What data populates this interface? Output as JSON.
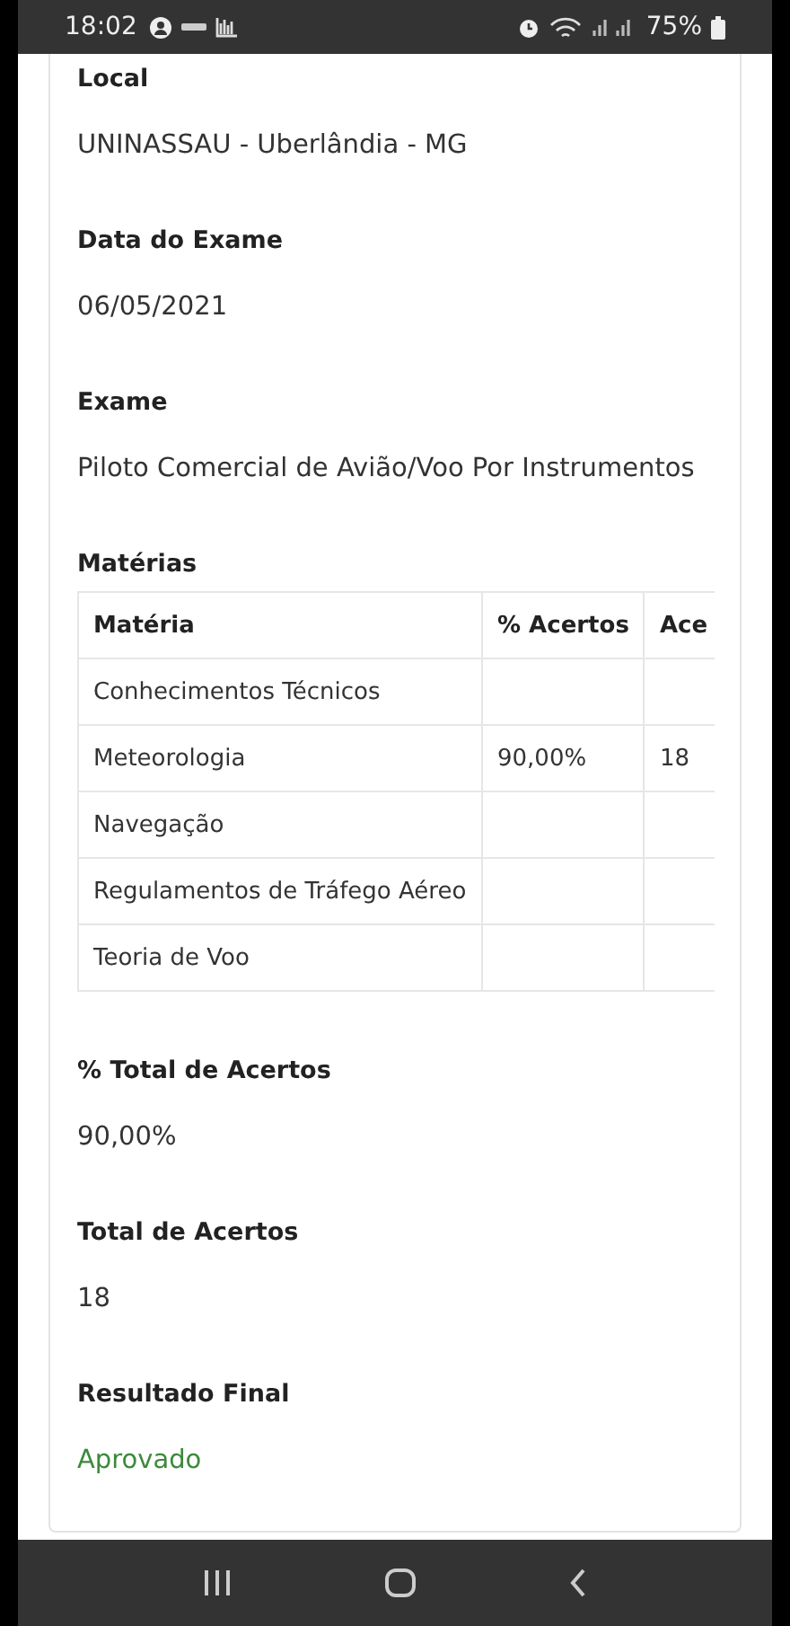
{
  "status_bar": {
    "time": "18:02",
    "battery": "75%"
  },
  "fields_top": [
    {
      "label": "Local",
      "value": "UNINASSAU - Uberlândia - MG"
    },
    {
      "label": "Data do Exame",
      "value": "06/05/2021"
    },
    {
      "label": "Exame",
      "value": "Piloto Comercial de Avião/Voo Por Instrumentos"
    }
  ],
  "materias": {
    "label": "Matérias",
    "columns": [
      "Matéria",
      "% Acertos",
      "Ace"
    ],
    "rows": [
      [
        "Conhecimentos Técnicos",
        "",
        ""
      ],
      [
        "Meteorologia",
        "90,00%",
        "18"
      ],
      [
        "Navegação",
        "",
        ""
      ],
      [
        "Regulamentos de Tráfego Aéreo",
        "",
        ""
      ],
      [
        "Teoria de Voo",
        "",
        ""
      ]
    ]
  },
  "fields_bottom": [
    {
      "label": "% Total de Acertos",
      "value": "90,00%",
      "kind": "plain"
    },
    {
      "label": "Total de Acertos",
      "value": "18",
      "kind": "plain"
    },
    {
      "label": "Resultado Final",
      "value": "Aprovado",
      "kind": "success"
    }
  ]
}
